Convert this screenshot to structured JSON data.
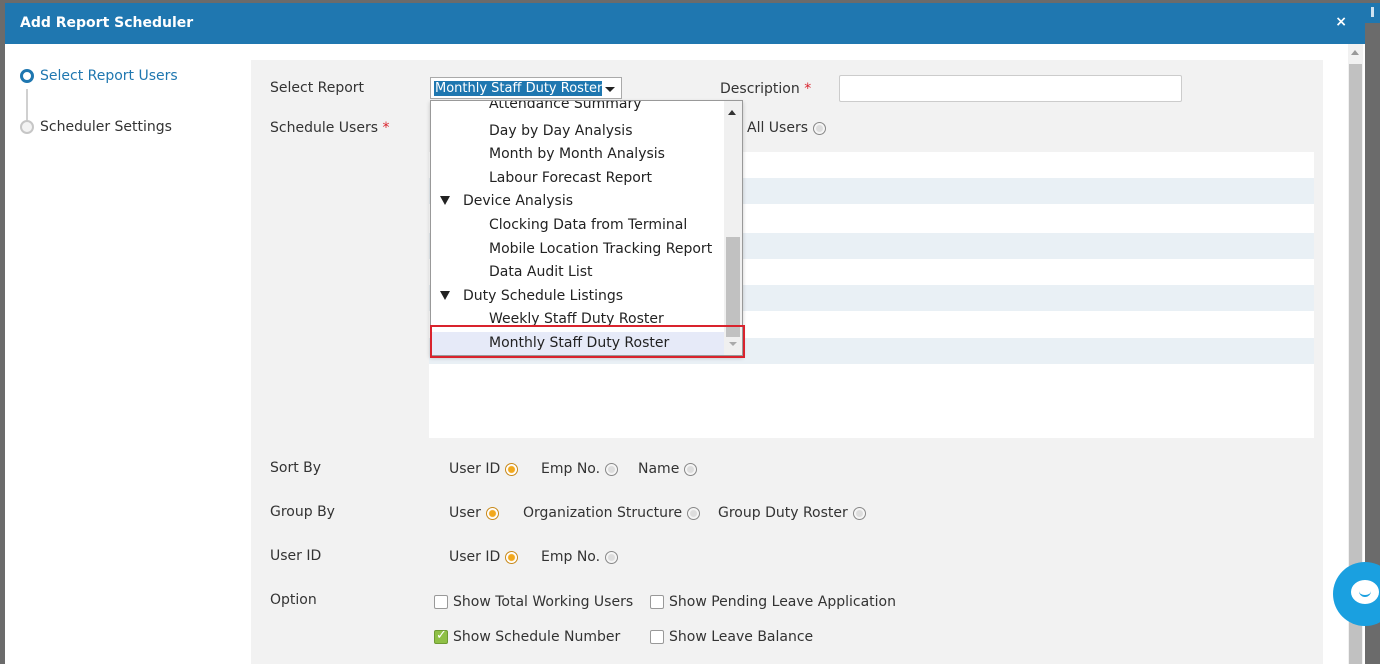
{
  "modal": {
    "title": "Add Report Scheduler",
    "close_label": "×"
  },
  "steps": [
    {
      "label": "Select Report Users",
      "active": true
    },
    {
      "label": "Scheduler Settings",
      "active": false
    }
  ],
  "form": {
    "select_report_label": "Select Report",
    "select_report_value": "Monthly Staff Duty Roster",
    "description_label": "Description",
    "description_value": "",
    "schedule_users_label": "Schedule Users",
    "required_mark": "*",
    "all_users_label": "All Users",
    "sort_by": {
      "label": "Sort By",
      "options": [
        "User ID",
        "Emp No.",
        "Name"
      ],
      "selected": "User ID"
    },
    "group_by": {
      "label": "Group By",
      "options": [
        "User",
        "Organization Structure",
        "Group Duty Roster"
      ],
      "selected": "User"
    },
    "user_id": {
      "label": "User ID",
      "options": [
        "User ID",
        "Emp No."
      ],
      "selected": "User ID"
    },
    "option": {
      "label": "Option",
      "checkboxes": [
        {
          "label": "Show Total Working Users",
          "checked": false
        },
        {
          "label": "Show Pending Leave Application",
          "checked": false
        },
        {
          "label": "Show Schedule Number",
          "checked": true
        },
        {
          "label": "Show Leave Balance",
          "checked": false
        }
      ]
    }
  },
  "dropdown": {
    "items": [
      {
        "label": "Attendance Summary",
        "type": "child"
      },
      {
        "label": "Day by Day Analysis",
        "type": "child"
      },
      {
        "label": "Month by Month Analysis",
        "type": "child"
      },
      {
        "label": "Labour Forecast Report",
        "type": "child"
      },
      {
        "label": "Device Analysis",
        "type": "group"
      },
      {
        "label": "Clocking Data from Terminal",
        "type": "child"
      },
      {
        "label": "Mobile Location Tracking Report",
        "type": "child"
      },
      {
        "label": "Data Audit List",
        "type": "child"
      },
      {
        "label": "Duty Schedule Listings",
        "type": "group"
      },
      {
        "label": "Weekly Staff Duty Roster",
        "type": "child"
      },
      {
        "label": "Monthly Staff Duty Roster",
        "type": "child",
        "selected": true
      }
    ]
  },
  "colors": {
    "header": "#1f77b0",
    "highlight": "#d9232d",
    "radio_on": "#f2a81c",
    "checkbox_on": "#8fc046"
  }
}
